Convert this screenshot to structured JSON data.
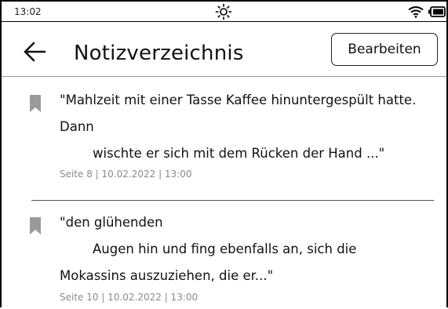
{
  "status_bar": {
    "time": "13:02",
    "icons": [
      "brightness-icon",
      "wifi-icon",
      "battery-icon"
    ]
  },
  "header": {
    "back_icon": "arrow-left-icon",
    "title": "Notizverzeichnis",
    "edit_label": "Bearbeiten"
  },
  "notes": [
    {
      "icon": "bookmark-icon",
      "lines": [
        "\"Mahlzeit mit einer Tasse Kaffee hinuntergespült hatte.",
        "Dann",
        "wischte er sich mit dem Rücken der Hand ...\""
      ],
      "meta": "Seite 8 | 10.02.2022 | 13:00"
    },
    {
      "icon": "bookmark-icon",
      "lines": [
        "\"den glühenden",
        "Augen hin und fing ebenfalls an, sich die",
        "Mokassins auszuziehen, die er...\""
      ],
      "meta": "Seite 10 | 10.02.2022 | 13:00"
    }
  ],
  "colors": {
    "text": "#111111",
    "meta": "#8a8a8a",
    "bookmark": "#9a9a9a",
    "divider": "#555555"
  }
}
